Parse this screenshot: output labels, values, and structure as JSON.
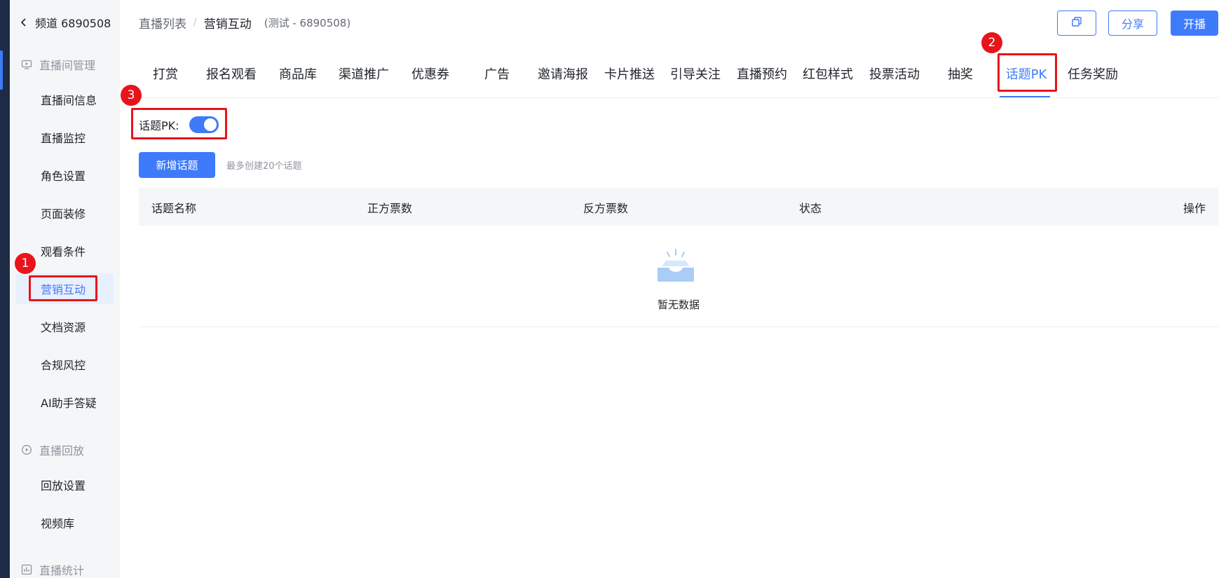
{
  "sidebar": {
    "channel_label": "频道 6890508",
    "groups": [
      {
        "label": "直播间管理",
        "icon": "monitor-icon"
      },
      {
        "label": "直播回放",
        "icon": "replay-icon"
      },
      {
        "label": "直播统计",
        "icon": "chart-icon"
      }
    ],
    "items": [
      {
        "label": "直播间信息"
      },
      {
        "label": "直播监控"
      },
      {
        "label": "角色设置"
      },
      {
        "label": "页面装修"
      },
      {
        "label": "观看条件"
      },
      {
        "label": "营销互动",
        "active": true
      },
      {
        "label": "文档资源"
      },
      {
        "label": "合规风控"
      },
      {
        "label": "AI助手答疑"
      },
      {
        "label": "回放设置"
      },
      {
        "label": "视频库"
      }
    ]
  },
  "header": {
    "breadcrumb_parent": "直播列表",
    "breadcrumb_separator": "/",
    "breadcrumb_current": "营销互动",
    "channel_meta": "(测试 - 6890508)",
    "share_label": "分享",
    "go_live_label": "开播",
    "copy_icon": "copy-icon"
  },
  "tabs": [
    {
      "label": "打赏"
    },
    {
      "label": "报名观看"
    },
    {
      "label": "商品库"
    },
    {
      "label": "渠道推广"
    },
    {
      "label": "优惠券"
    },
    {
      "label": "广告"
    },
    {
      "label": "邀请海报"
    },
    {
      "label": "卡片推送"
    },
    {
      "label": "引导关注"
    },
    {
      "label": "直播预约"
    },
    {
      "label": "红包样式"
    },
    {
      "label": "投票活动"
    },
    {
      "label": "抽奖"
    },
    {
      "label": "话题PK",
      "active": true
    },
    {
      "label": "任务奖励"
    }
  ],
  "topic_pk": {
    "toggle_label": "话题PK:",
    "enabled": true,
    "add_button_label": "新增话题",
    "add_hint": "最多创建20个话题"
  },
  "table": {
    "columns": [
      "话题名称",
      "正方票数",
      "反方票数",
      "状态",
      "操作"
    ],
    "rows": [],
    "empty_text": "暂无数据"
  },
  "annotations": [
    {
      "number": "1"
    },
    {
      "number": "2"
    },
    {
      "number": "3"
    }
  ],
  "colors": {
    "accent": "#3e7bfa",
    "annotation_red": "#e8141b",
    "sidebar_bg": "#f5f6f8",
    "dark_strip": "#1f2a44"
  }
}
